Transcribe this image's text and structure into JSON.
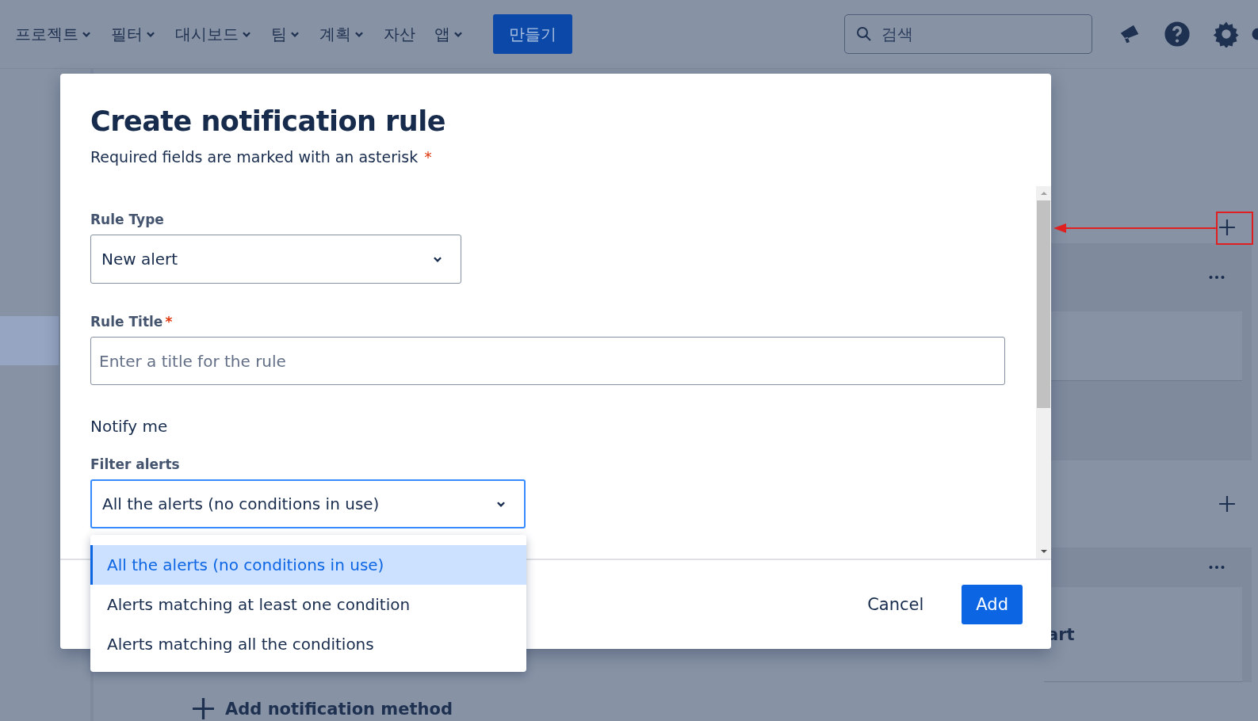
{
  "nav": {
    "items": [
      {
        "label": "프로젝트",
        "dropdown": true
      },
      {
        "label": "필터",
        "dropdown": true
      },
      {
        "label": "대시보드",
        "dropdown": true
      },
      {
        "label": "팀",
        "dropdown": true
      },
      {
        "label": "계획",
        "dropdown": true
      },
      {
        "label": "자산",
        "dropdown": false
      },
      {
        "label": "앱",
        "dropdown": true
      }
    ],
    "create_button": "만들기",
    "search": {
      "placeholder": "검색"
    }
  },
  "background": {
    "partial_text": "art",
    "add_method": "Add notification method"
  },
  "dialog": {
    "title": "Create notification rule",
    "subtitle": "Required fields are marked with an asterisk",
    "asterisk": "*",
    "fields": [
      {
        "kind": "select",
        "label": "Rule Type",
        "required": false,
        "value": "New alert",
        "focused": false
      },
      {
        "kind": "text",
        "label": "Rule Title",
        "required": true,
        "placeholder": "Enter a title for the rule"
      },
      {
        "kind": "heading",
        "label": "Notify me"
      },
      {
        "kind": "select",
        "label": "Filter alerts",
        "required": false,
        "value": "All the alerts (no conditions in use)",
        "focused": true
      }
    ],
    "menu": [
      {
        "label": "All the alerts (no conditions in use)",
        "selected": true
      },
      {
        "label": "Alerts matching at least one condition",
        "selected": false
      },
      {
        "label": "Alerts matching all the conditions",
        "selected": false
      }
    ],
    "buttons": [
      {
        "label": "Cancel",
        "kind": "subtle"
      },
      {
        "label": "Add",
        "kind": "primary"
      }
    ]
  }
}
